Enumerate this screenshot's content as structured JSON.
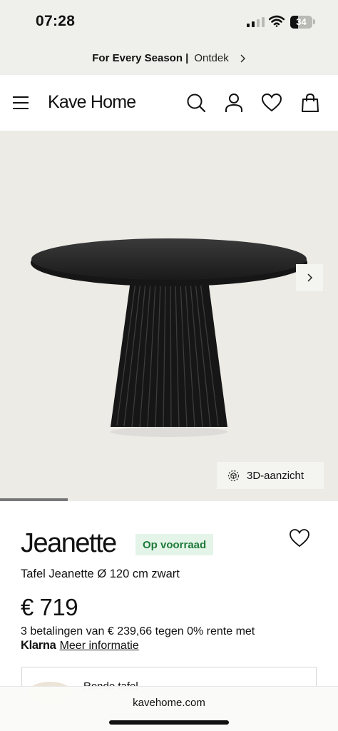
{
  "status_bar": {
    "time": "07:28",
    "battery_level": "34",
    "signal_bars_active": 2,
    "signal_bars_total": 4
  },
  "promo": {
    "bold_text": "For Every Season |",
    "link_text": "Ontdek"
  },
  "header": {
    "logo": "Kave Home"
  },
  "icons": {
    "menu": "hamburger-menu-icon",
    "search": "search-icon",
    "account": "user-icon",
    "wishlist": "heart-icon",
    "cart": "shopping-bag-icon",
    "next": "chevron-right-icon",
    "view_3d": "3d-cube-icon"
  },
  "gallery": {
    "view_3d_label": "3D-aanzicht",
    "progress": 0.2
  },
  "product": {
    "name": "Jeanette",
    "stock_status": "Op voorraad",
    "subtitle": "Tafel Jeanette Ø 120 cm zwart",
    "price": "€ 719",
    "installments": "3 betalingen van € 239,66 tegen 0% rente met",
    "klarna_brand": "Klarna",
    "more_info": "Meer informatie"
  },
  "related": {
    "title": "Ronde tafel"
  },
  "browser": {
    "url": "kavehome.com"
  },
  "colors": {
    "promo_background": "#efefeb",
    "gallery_background": "#ecebe6",
    "stock_badge_background": "#e5f4e8",
    "stock_badge_text": "#1e7a39",
    "text": "#111111"
  }
}
